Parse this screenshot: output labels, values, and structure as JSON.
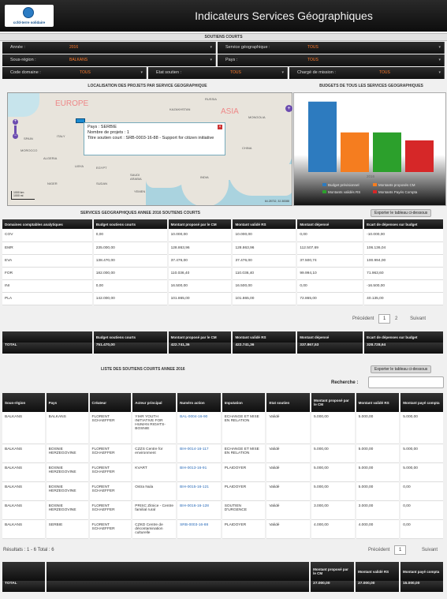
{
  "header": {
    "logo_text": "ccfd-terre solidaire",
    "title": "Indicateurs Services Géographiques"
  },
  "filters_band": "SOUTIENS COURTS",
  "filters": {
    "annee": {
      "label": "Année :",
      "value": "2016"
    },
    "service": {
      "label": "Service géographique :",
      "value": "TOUS"
    },
    "sousregion": {
      "label": "Sous-région :",
      "value": "BALKANS"
    },
    "pays": {
      "label": "Pays :",
      "value": "TOUS"
    },
    "code_domaine": {
      "label": "Code domaine :",
      "value": "TOUS"
    },
    "etat": {
      "label": "Etat soutien :",
      "value": "TOUS"
    },
    "charge": {
      "label": "Chargé de mission :",
      "value": "TOUS"
    }
  },
  "map": {
    "title": "LOCALISATION DES PROJETS PAR SERVICE GEOGRAPHIQUE",
    "labels": {
      "europe": "EUROPE",
      "asia": "ASIA",
      "russia": "RUSSIA",
      "kazakhstan": "KAZAKHSTAN",
      "mongolia": "MONGOLIA",
      "china": "CHINA",
      "morocco": "MOROCCO",
      "algeria": "ALGERIA",
      "libya": "LIBYA",
      "egypt": "EGYPT",
      "saudi": "SAUDI ARABIA",
      "iran": "IRAN",
      "india": "INDIA",
      "sudan": "SUDAN",
      "yemen": "YEMEN",
      "italy": "ITALY",
      "spain": "SPAIN",
      "niger": "NIGER"
    },
    "scale_km": "1000 km",
    "scale_mi": "1000 mi",
    "coords": "64.28732, 32.38388",
    "popup": {
      "line1": "Pays : SERBIE",
      "line2": "Nombre de projets : 1",
      "line3": "Titre soutien court : SRB-0003-16-88 - Support for citizen initiative"
    }
  },
  "budget_chart": {
    "title": "BUDGETS DE TOUS LES SERVICES GEOGRAPHIQUES",
    "x_label": "2016",
    "legend": [
      {
        "name": "Budget prévisionnel",
        "color": "#2d7bbf"
      },
      {
        "name": "Montants proposés CM",
        "color": "#f57d1f"
      },
      {
        "name": "Montants validés RS",
        "color": "#2ca02c"
      },
      {
        "name": "Montants Payés Compta",
        "color": "#d62728"
      }
    ]
  },
  "chart_data": {
    "type": "bar",
    "title": "BUDGETS DE TOUS LES SERVICES GEOGRAPHIQUES",
    "categories": [
      "2016"
    ],
    "series": [
      {
        "name": "Budget prévisionnel",
        "values": [
          751470
        ]
      },
      {
        "name": "Montants proposés CM",
        "values": [
          422741.36
        ]
      },
      {
        "name": "Montants validés RS",
        "values": [
          422741.36
        ]
      },
      {
        "name": "Montants Payés Compta",
        "values": [
          337867.53
        ]
      }
    ],
    "ylim": [
      0,
      800000
    ],
    "grid": false,
    "legend_position": "bottom"
  },
  "table1": {
    "title": "SERVICES GEOGRAPHIQUES ANNEE 2016 SOUTIENS COURTS",
    "export": "Exporter le tableau ci-dessous",
    "headers": [
      "Domaines comptables analytiques",
      "Budget soutiens courts",
      "Montant proposé par le CM",
      "Montant validé RS",
      "Montant dépensé",
      "Ecart de dépenses sur budget"
    ],
    "rows": [
      [
        "COV",
        "0,00",
        "10.000,00",
        "10.000,00",
        "0,00",
        "-10.000,00"
      ],
      [
        "EMR",
        "235.000,00",
        "128.863,96",
        "128.863,96",
        "112.507,69",
        "106.136,04"
      ],
      [
        "EVA",
        "138.470,00",
        "37.476,00",
        "37.476,00",
        "37.500,74",
        "100.994,00"
      ],
      [
        "FOR",
        "182.000,00",
        "110.036,40",
        "110.036,40",
        "99.994,10",
        "71.963,60"
      ],
      [
        "INI",
        "0,00",
        "16.500,00",
        "16.500,00",
        "0,00",
        "-16.500,00"
      ],
      [
        "PLA",
        "142.000,00",
        "101.865,00",
        "101.865,00",
        "72.865,00",
        "40.135,00"
      ]
    ],
    "pager": {
      "prev": "Précédent",
      "current": "1",
      "next_page": "2",
      "next": "Suivant"
    },
    "total_headers": [
      "",
      "Budget soutiens courts",
      "Montant proposé par le CM",
      "Montant validé RS",
      "Montant dépensé",
      "Ecart de dépenses sur budget"
    ],
    "total_row": [
      "TOTAL",
      "751.470,00",
      "422.741,36",
      "422.741,36",
      "337.867,53",
      "328.728,64"
    ]
  },
  "table2": {
    "title": "LISTE DES SOUTIENS COURTS ANNEE 2016",
    "export": "Exporter le tableau ci-dessous",
    "search_label": "Recherche :",
    "headers": [
      "Sous-région",
      "Pays",
      "Créateur",
      "Acteur principal",
      "Numéro action",
      "Imputation",
      "Etat soutien",
      "Montant proposé par le CM",
      "Montant validé RS",
      "Montant payé compta"
    ],
    "rows": [
      [
        "BALKANS",
        "BALKANS",
        "FLORENT SCHAEFFER",
        "YIHR YOUTH INITIATIVE FOR HUMAN RIGHTS-BOSNIE",
        "BAL-0004-16-90",
        "ECHANGE ET MISE EN RELATION",
        "Validé",
        "5.000,00",
        "5.000,00",
        "5.000,00"
      ],
      [
        "BALKANS",
        "BOSNIE HERZEGOVINE",
        "FLORENT SCHAEFFER",
        "CZZS Centre for environment",
        "BIH-0014-16-117",
        "ECHANGE ET MISE EN RELATION",
        "Validé",
        "5.000,00",
        "5.000,00",
        "5.000,00"
      ],
      [
        "BALKANS",
        "BOSNIE HERZEGOVINE",
        "FLORENT SCHAEFFER",
        "KVART",
        "BIH-0013-16-91",
        "PLAIDOYER",
        "Validé",
        "5.000,00",
        "5.000,00",
        "5.000,00"
      ],
      [
        "BALKANS",
        "BOSNIE HERZEGOVINE",
        "FLORENT SCHAEFFER",
        "Ostra Nula",
        "BIH-0015-16-121",
        "PLAIDOYER",
        "Validé",
        "5.000,00",
        "5.000,00",
        "0,00"
      ],
      [
        "BALKANS",
        "BOSNIE HERZEGOVINE",
        "FLORENT SCHAEFFER",
        "PRISC Zitnice - Centre familial rural",
        "BIH-0016-16-128",
        "SOUTIEN D'URGENCE",
        "Validé",
        "3.000,00",
        "3.000,00",
        "0,00"
      ],
      [
        "BALKANS",
        "SERBIE",
        "FLORENT SCHAEFFER",
        "CZKD Centre de décontamination culturelle",
        "SRB-0003-16-88",
        "PLAIDOYER",
        "Validé",
        "4.000,00",
        "4.000,00",
        "0,00"
      ]
    ],
    "results": "Résultats : 1 - 6 Total : 6",
    "pager": {
      "prev": "Précédent",
      "current": "1",
      "next": "Suivant"
    },
    "total_headers": [
      "Montant proposé par le CM",
      "Montant validé RS",
      "Montant payé compta"
    ],
    "total_row": [
      "TOTAL",
      "27.000,00",
      "27.000,00",
      "15.000,00"
    ]
  }
}
